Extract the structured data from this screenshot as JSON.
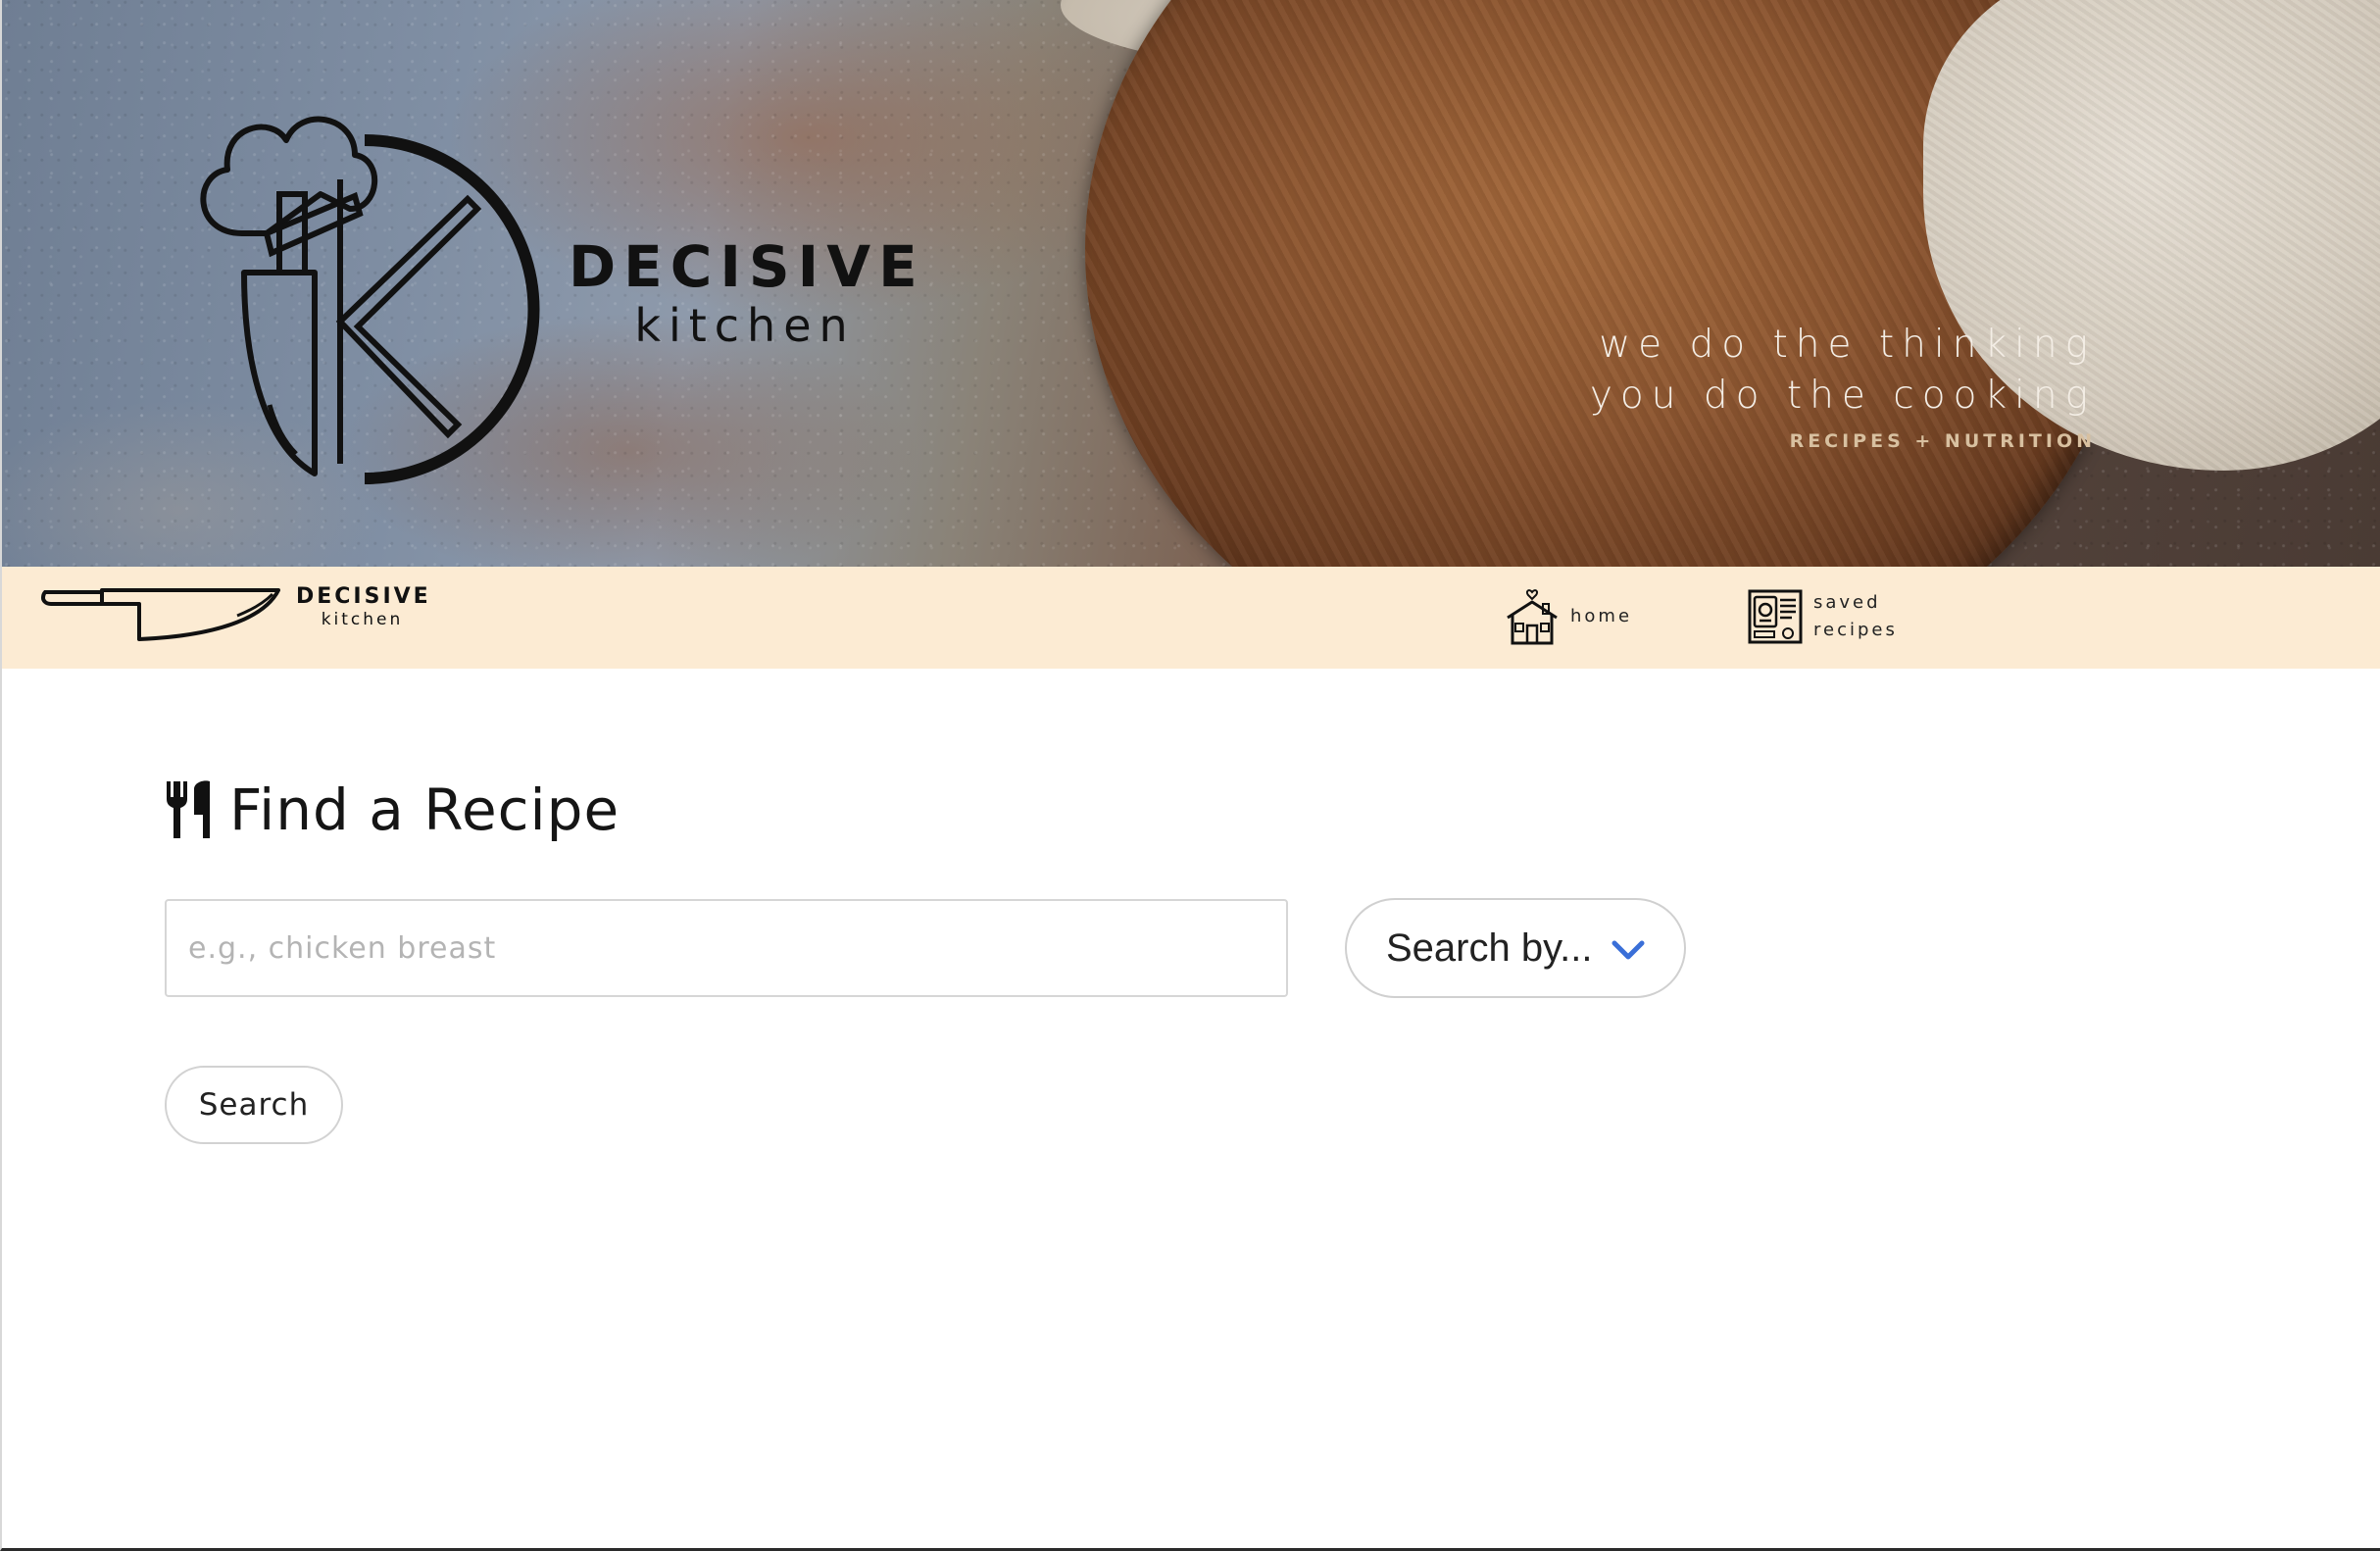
{
  "hero": {
    "brand_line1": "DECISIVE",
    "brand_line2": "kitchen",
    "tagline_line1": "we do the thinking",
    "tagline_line2": "you do the cooking",
    "tagline_sub": "RECIPES + NUTRITION",
    "logo_icon": "chef-knife-k-logo-icon"
  },
  "nav": {
    "brand_line1": "DECISIVE",
    "brand_line2": "kitchen",
    "logo_icon": "knife-icon",
    "items": [
      {
        "label": "home",
        "icon": "house-icon"
      },
      {
        "label": "saved recipes",
        "icon": "recipe-book-icon"
      }
    ]
  },
  "main": {
    "title": "Find a Recipe",
    "title_icon": "utensils-icon",
    "search_placeholder": "e.g., chicken breast",
    "search_value": "",
    "select_label": "Search by...",
    "select_icon": "chevron-down-icon",
    "search_button": "Search"
  },
  "colors": {
    "navbar_bg": "#fcebd3",
    "chevron": "#3a6fd8",
    "text": "#151515"
  }
}
